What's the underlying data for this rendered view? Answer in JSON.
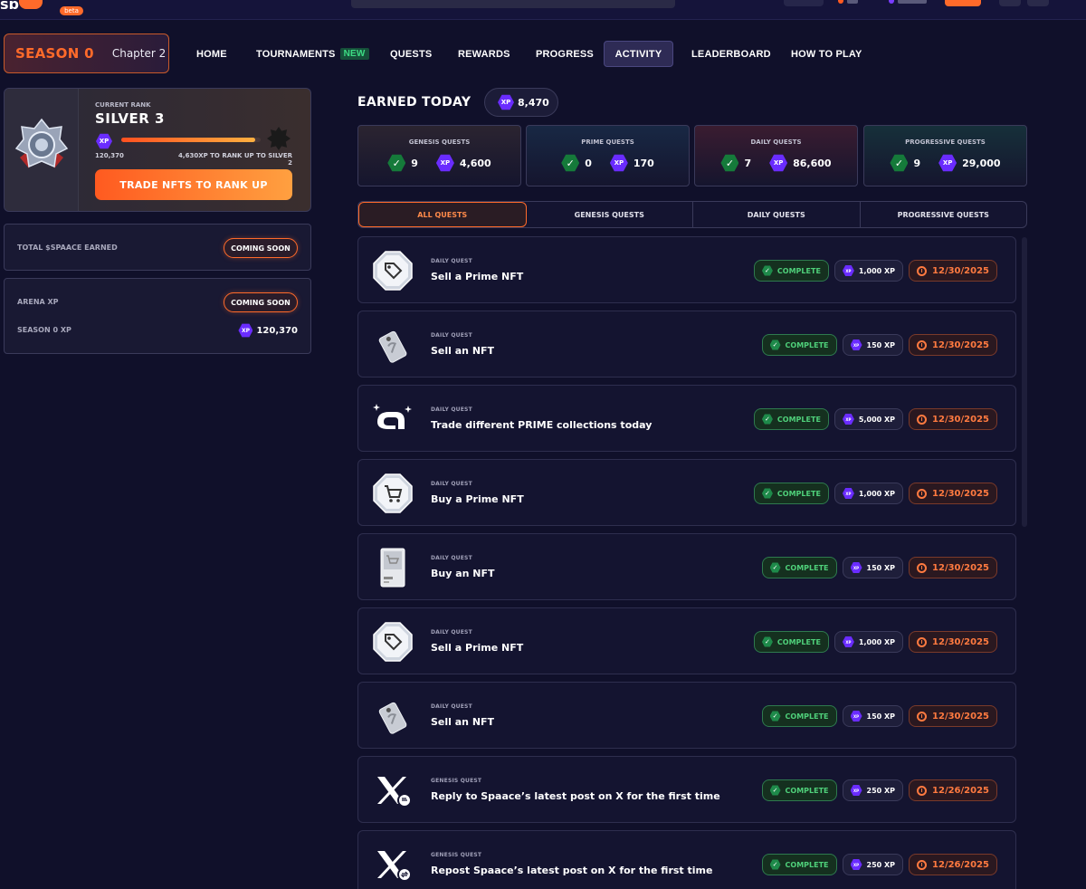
{
  "header": {
    "logo_text": "sp",
    "beta": "beta"
  },
  "nav": {
    "season_title": "SEASON 0",
    "chapter": "Chapter 2",
    "items": [
      {
        "label": "HOME"
      },
      {
        "label": "TOURNAMENTS",
        "badge": "NEW"
      },
      {
        "label": "QUESTS"
      },
      {
        "label": "REWARDS"
      },
      {
        "label": "PROGRESS"
      },
      {
        "label": "ACTIVITY",
        "active": true
      },
      {
        "label": "LEADERBOARD"
      },
      {
        "label": "HOW TO PLAY"
      }
    ]
  },
  "rank": {
    "caption": "CURRENT RANK",
    "name": "SILVER 3",
    "xp_icon": "XP",
    "xp": "120,370",
    "to_rank_up": "4,630XP TO RANK UP TO SILVER 2",
    "progress_fraction": 0.96,
    "button": "TRADE NFTS TO RANK UP"
  },
  "stats": {
    "total_label": "TOTAL $SPAACE EARNED",
    "total_value": "COMING SOON",
    "arena_label": "ARENA XP",
    "arena_value": "COMING SOON",
    "season_label": "SEASON 0 XP",
    "season_value": "120,370"
  },
  "earned": {
    "title": "EARNED TODAY",
    "value": "8,470"
  },
  "categories": [
    {
      "label": "GENESIS QUESTS",
      "count": "9",
      "xp": "4,600",
      "bg": "#2b2430"
    },
    {
      "label": "PRIME QUESTS",
      "count": "0",
      "xp": "170",
      "bg": "#182844"
    },
    {
      "label": "DAILY QUESTS",
      "count": "7",
      "xp": "86,600",
      "bg": "#3a1c30"
    },
    {
      "label": "PROGRESSIVE QUESTS",
      "count": "9",
      "xp": "29,000",
      "bg": "#16303a"
    }
  ],
  "filters": [
    "ALL QUESTS",
    "GENESIS QUESTS",
    "DAILY QUESTS",
    "PROGRESSIVE QUESTS"
  ],
  "quests": [
    {
      "type": "DAILY QUEST",
      "name": "Sell a Prime NFT",
      "status": "COMPLETE",
      "xp": "1,000 XP",
      "date": "12/30/2025",
      "icon": "tag-badge-icon"
    },
    {
      "type": "DAILY QUEST",
      "name": "Sell an NFT",
      "status": "COMPLETE",
      "xp": "150 XP",
      "date": "12/30/2025",
      "icon": "price-tag-icon"
    },
    {
      "type": "DAILY QUEST",
      "name": "Trade different PRIME collections today",
      "status": "COMPLETE",
      "xp": "5,000 XP",
      "date": "12/30/2025",
      "icon": "prime-logo-icon"
    },
    {
      "type": "DAILY QUEST",
      "name": "Buy a Prime NFT",
      "status": "COMPLETE",
      "xp": "1,000 XP",
      "date": "12/30/2025",
      "icon": "cart-badge-icon"
    },
    {
      "type": "DAILY QUEST",
      "name": "Buy an NFT",
      "status": "COMPLETE",
      "xp": "150 XP",
      "date": "12/30/2025",
      "icon": "card-cart-icon"
    },
    {
      "type": "DAILY QUEST",
      "name": "Sell a Prime NFT",
      "status": "COMPLETE",
      "xp": "1,000 XP",
      "date": "12/30/2025",
      "icon": "tag-badge-icon"
    },
    {
      "type": "DAILY QUEST",
      "name": "Sell an NFT",
      "status": "COMPLETE",
      "xp": "150 XP",
      "date": "12/30/2025",
      "icon": "price-tag-icon"
    },
    {
      "type": "GENESIS QUEST",
      "name": "Reply to Spaace’s latest post on X for the first time",
      "status": "COMPLETE",
      "xp": "250 XP",
      "date": "12/26/2025",
      "icon": "x-reply-icon"
    },
    {
      "type": "GENESIS QUEST",
      "name": "Repost Spaace’s latest post on X for the first time",
      "status": "COMPLETE",
      "xp": "250 XP",
      "date": "12/26/2025",
      "icon": "x-repost-icon"
    }
  ],
  "colors": {
    "accent": "#ff6a2a",
    "xp_purple": "#6a2cff",
    "complete_green": "#4fd07a",
    "background": "#10102a"
  }
}
